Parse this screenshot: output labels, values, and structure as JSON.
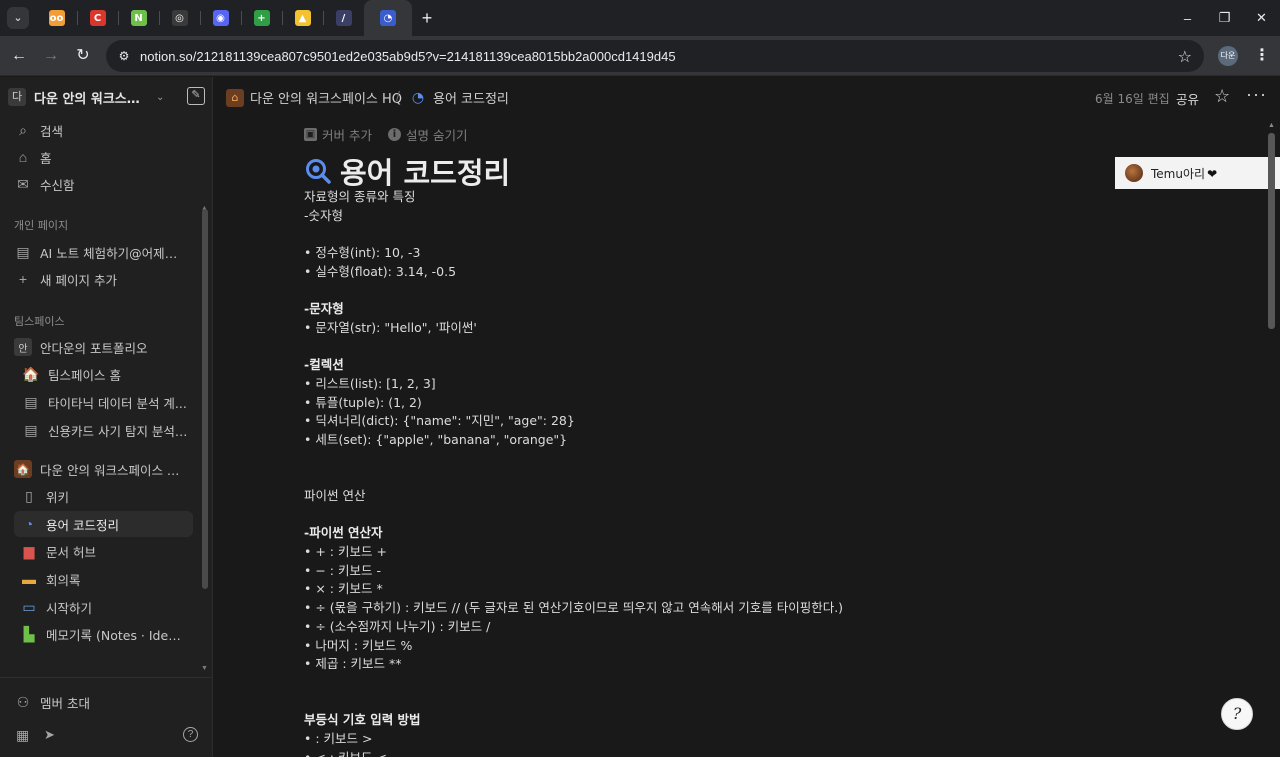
{
  "browser": {
    "tab_menu_icon": "chevron-down-icon",
    "tabs": [
      {
        "icon": "glasses-favicon",
        "glyph": "oo",
        "color": "#f29d38"
      },
      {
        "icon": "red-c-favicon",
        "glyph": "C",
        "color": "#d9362e"
      },
      {
        "icon": "n-favicon",
        "glyph": "N",
        "color": "#6fbf4b"
      },
      {
        "icon": "openai-favicon",
        "glyph": "◎",
        "color": "#3a3a3a"
      },
      {
        "icon": "discord-favicon",
        "glyph": "◉",
        "color": "#5865f2"
      },
      {
        "icon": "sheets-plus-favicon",
        "glyph": "+",
        "color": "#2f9e44"
      },
      {
        "icon": "drive-favicon",
        "glyph": "▲",
        "color": "#f2c230"
      },
      {
        "icon": "slash-favicon",
        "glyph": "/",
        "color": "#3b3f66"
      },
      {
        "icon": "notion-page-favicon",
        "glyph": "◔",
        "color": "#3b5ccc"
      }
    ],
    "newtab_glyph": "+",
    "window_controls": [
      "–",
      "❐",
      "✕"
    ],
    "back_glyph": "←",
    "forward_glyph": "→",
    "reload_glyph": "↻",
    "site_info_glyph": "⚙",
    "url": "notion.so/212181139cea807c9501ed2e035ab9d5?v=214181139cea8015bb2a000cd1419d45",
    "bookmark_glyph": "☆",
    "profile_initials": "다운",
    "menu_glyph": "⋮"
  },
  "sidebar": {
    "workspace_badge": "다",
    "workspace_name": "다운 안의 워크스페이스",
    "chevron_glyph": "⌄",
    "compose_glyph": "✎",
    "top_items": [
      {
        "label": "검색",
        "icon": "search-icon",
        "glyph": "⌕"
      },
      {
        "label": "홈",
        "icon": "home-icon",
        "glyph": "⌂"
      },
      {
        "label": "수신함",
        "icon": "inbox-icon",
        "glyph": "✉"
      }
    ],
    "personal_header": "개인 페이지",
    "personal_items": [
      {
        "label": "AI 노트 체험하기@어제 ...",
        "icon": "page-icon",
        "glyph": "▤"
      },
      {
        "label": "새 페이지 추가",
        "icon": "plus-icon",
        "glyph": "+"
      }
    ],
    "teamspace_header": "팀스페이스",
    "teamspace_items": [
      {
        "label": "안다운의 포트폴리오",
        "icon": "an-badge-icon",
        "glyph": "안"
      },
      {
        "label": "팀스페이스 홈",
        "icon": "building-icon",
        "glyph": "🏠"
      },
      {
        "label": "타이타닉 데이터 분석 계...",
        "icon": "page-icon",
        "glyph": "▤"
      },
      {
        "label": "신용카드 사기 탐지 분석 ...",
        "icon": "page-icon",
        "glyph": "▤"
      }
    ],
    "hq_item": {
      "label": "다운 안의 워크스페이스 HQ",
      "icon": "house-emoji-icon",
      "glyph": "🏠"
    },
    "hq_children": [
      {
        "label": "위키",
        "icon": "book-icon",
        "glyph": "▯"
      },
      {
        "label": "용어 코드정리",
        "icon": "search-magnifier-page-icon",
        "glyph": "◔",
        "selected": true
      },
      {
        "label": "문서 허브",
        "icon": "red-doc-icon",
        "glyph": "▆"
      },
      {
        "label": "회의록",
        "icon": "folder-icon",
        "glyph": "▬"
      },
      {
        "label": "시작하기",
        "icon": "laptop-icon",
        "glyph": "▭"
      },
      {
        "label": "메모기록 (Notes · Ideas...",
        "icon": "sticky-note-icon",
        "glyph": "▙"
      }
    ],
    "invite_label": "멤버 초대",
    "invite_glyph": "⚇",
    "calendar_glyph": "▦",
    "send_glyph": "➤",
    "help_glyph": "?"
  },
  "page_header": {
    "breadcrumb_root": "다운 안의 워크스페이스 HQ",
    "breadcrumb_sep": "/",
    "breadcrumb_current": "용어 코드정리",
    "edited": "6월 16일 편집",
    "share_label": "공유",
    "favorite_glyph": "☆",
    "more_glyph": "···"
  },
  "doc": {
    "add_cover": "커버 추가",
    "hide_description": "설명 숨기기",
    "title": "용어 코드정리",
    "lines": [
      {
        "text": "자료형의 종류와 특징",
        "bold": false
      },
      {
        "text": "-숫자형",
        "bold": false
      },
      {
        "text": "",
        "bold": false
      },
      {
        "text": "• 정수형(int): 10, -3",
        "bold": false
      },
      {
        "text": "• 실수형(float): 3.14, -0.5",
        "bold": false
      },
      {
        "text": "",
        "bold": false
      },
      {
        "text": "-문자형",
        "bold": true
      },
      {
        "text": "• 문자열(str): \"Hello\", '파이썬'",
        "bold": false
      },
      {
        "text": "",
        "bold": false
      },
      {
        "text": "-컬렉션",
        "bold": true
      },
      {
        "text": "• 리스트(list): [1, 2, 3]",
        "bold": false
      },
      {
        "text": "• 튜플(tuple): (1, 2)",
        "bold": false
      },
      {
        "text": "• 딕셔너리(dict): {\"name\": \"지민\", \"age\": 28}",
        "bold": false
      },
      {
        "text": "• 세트(set): {\"apple\", \"banana\", \"orange\"}",
        "bold": false
      },
      {
        "text": "",
        "bold": false
      },
      {
        "text": "",
        "bold": false
      },
      {
        "text": "파이썬 연산",
        "bold": false
      },
      {
        "text": "",
        "bold": false
      },
      {
        "text": "-파이썬 연산자",
        "bold": true
      },
      {
        "text": "• + : 키보드 +",
        "bold": false
      },
      {
        "text": "• − : 키보드 -",
        "bold": false
      },
      {
        "text": "• × : 키보드 *",
        "bold": false
      },
      {
        "text": "• ÷ (몫을 구하기) : 키보드 // (두 글자로 된 연산기호이므로 띄우지 않고 연속해서 기호를 타이핑한다.)",
        "bold": false
      },
      {
        "text": "• ÷ (소수점까지 나누기) : 키보드 /",
        "bold": false
      },
      {
        "text": "• 나머지 : 키보드 %",
        "bold": false
      },
      {
        "text": "• 제곱 : 키보드 **",
        "bold": false
      },
      {
        "text": "",
        "bold": false
      },
      {
        "text": "",
        "bold": false
      },
      {
        "text": "부등식 기호 입력 방법",
        "bold": true
      },
      {
        "text": "• : 키보드 >",
        "bold": false
      },
      {
        "text": "• < : 키보드 <",
        "bold": false
      }
    ]
  },
  "comment": {
    "author": "Temu아리",
    "heart": "❤"
  },
  "help_fab_glyph": "?"
}
